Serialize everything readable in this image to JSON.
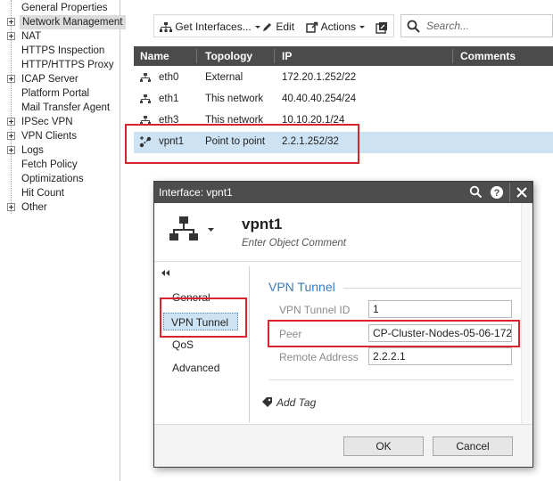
{
  "tree": {
    "items": [
      {
        "label": "General Properties",
        "expandable": false,
        "selected": false
      },
      {
        "label": "Network Management",
        "expandable": true,
        "selected": true
      },
      {
        "label": "NAT",
        "expandable": true,
        "selected": false
      },
      {
        "label": "HTTPS Inspection",
        "expandable": false,
        "selected": false
      },
      {
        "label": "HTTP/HTTPS Proxy",
        "expandable": false,
        "selected": false
      },
      {
        "label": "ICAP Server",
        "expandable": true,
        "selected": false
      },
      {
        "label": "Platform Portal",
        "expandable": false,
        "selected": false
      },
      {
        "label": "Mail Transfer Agent",
        "expandable": false,
        "selected": false
      },
      {
        "label": "IPSec VPN",
        "expandable": true,
        "selected": false
      },
      {
        "label": "VPN Clients",
        "expandable": true,
        "selected": false
      },
      {
        "label": "Logs",
        "expandable": true,
        "selected": false
      },
      {
        "label": "Fetch Policy",
        "expandable": false,
        "selected": false
      },
      {
        "label": "Optimizations",
        "expandable": false,
        "selected": false
      },
      {
        "label": "Hit Count",
        "expandable": false,
        "selected": false
      },
      {
        "label": "Other",
        "expandable": true,
        "selected": false
      }
    ]
  },
  "toolbar": {
    "get_interfaces_label": "Get Interfaces...",
    "edit_label": "Edit",
    "actions_label": "Actions",
    "search_placeholder": "Search..."
  },
  "grid": {
    "columns": [
      "Name",
      "Topology",
      "IP",
      "Comments"
    ],
    "rows": [
      {
        "name": "eth0",
        "topology": "External",
        "ip": "172.20.1.252/22",
        "comments": ""
      },
      {
        "name": "eth1",
        "topology": "This network",
        "ip": "40.40.40.254/24",
        "comments": ""
      },
      {
        "name": "eth3",
        "topology": "This network",
        "ip": "10.10.20.1/24",
        "comments": ""
      },
      {
        "name": "vpnt1",
        "topology": "Point to point",
        "ip": "2.2.1.252/32",
        "comments": ""
      }
    ],
    "selected_row": 3
  },
  "dialog": {
    "title": "Interface: vpnt1",
    "object_name": "vpnt1",
    "object_comment_placeholder": "Enter Object Comment",
    "nav": [
      "General",
      "VPN Tunnel",
      "QoS",
      "Advanced"
    ],
    "active_nav": "VPN Tunnel",
    "section_title": "VPN Tunnel",
    "fields": [
      {
        "label": "VPN Tunnel ID",
        "value": "1"
      },
      {
        "label": "Peer",
        "value": "CP-Cluster-Nodes-05-06-172."
      },
      {
        "label": "Remote Address",
        "value": "2.2.2.1"
      }
    ],
    "add_tag_label": "Add Tag",
    "ok_label": "OK",
    "cancel_label": "Cancel"
  },
  "colors": {
    "highlight_box": "#d9232d",
    "selection": "#cde2f3",
    "section_title": "#3a7bbf",
    "header_bg": "#4b4b4b"
  }
}
